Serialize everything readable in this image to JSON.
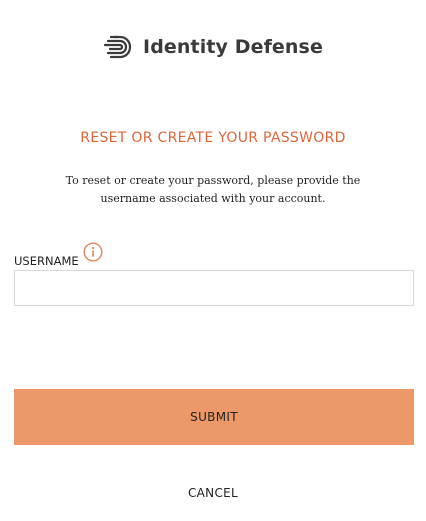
{
  "brand": {
    "name": "Identity Defense",
    "logo_icon": "fingerprint-icon"
  },
  "form": {
    "heading": "RESET OR CREATE YOUR PASSWORD",
    "description": "To reset or create your password, please provide the username associated with your account.",
    "username_label": "USERNAME",
    "username_value": "",
    "username_placeholder": "",
    "info_icon": "info-icon",
    "submit_label": "SUBMIT",
    "cancel_label": "CANCEL"
  },
  "colors": {
    "accent": "#d9673a",
    "button": "#ec9868"
  }
}
